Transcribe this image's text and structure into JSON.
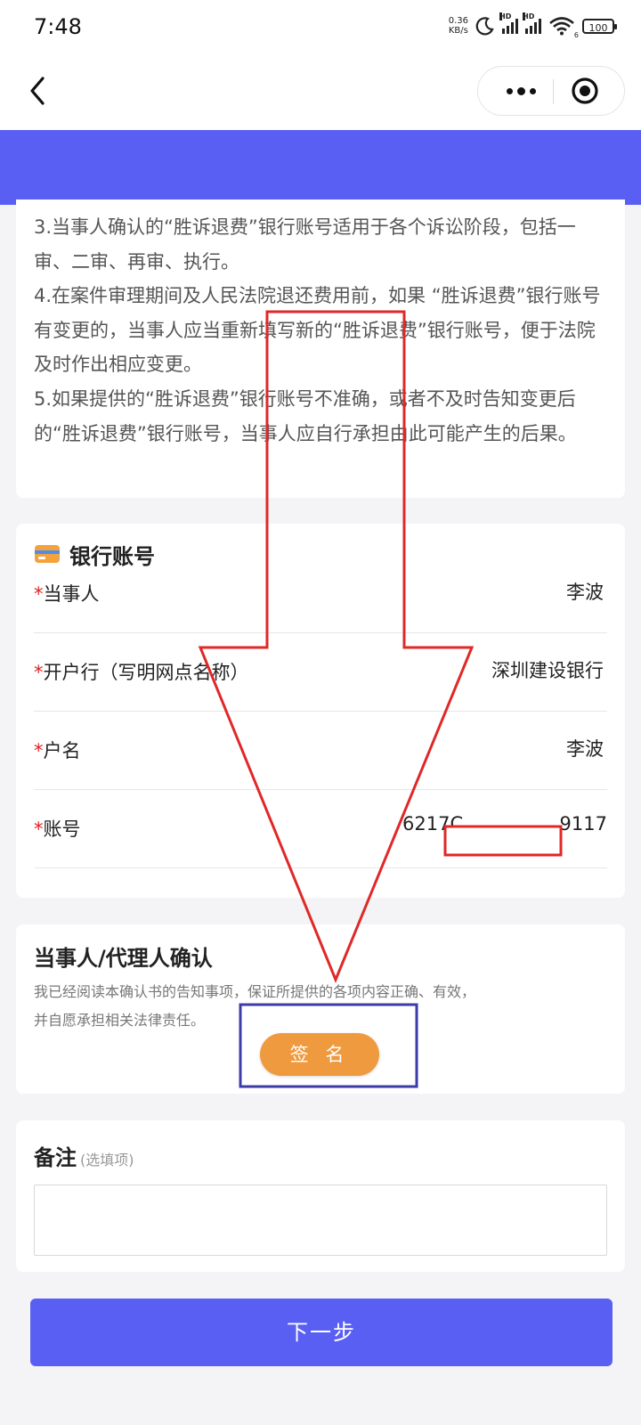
{
  "status_bar": {
    "time": "7:48",
    "net_speed_value": "0.36",
    "net_speed_unit": "KB/s",
    "signal_label_1": "HD",
    "signal_label_2": "HD",
    "wifi_label": "6",
    "battery": "100",
    "icons": [
      "moon-icon",
      "signal-icon",
      "wifi-icon",
      "battery-icon"
    ]
  },
  "nav": {
    "back_icon": "chevron-left-icon",
    "more_icon": "more-dots-icon",
    "close_icon": "target-close-icon"
  },
  "notice": {
    "paragraphs": [
      "3.当事人确认的“胜诉退费”银行账号适用于各个诉讼阶段，包括一审、二审、再审、执行。",
      "4.在案件审理期间及人民法院退还费用前，如果 “胜诉退费”银行账号有变更的，当事人应当重新填写新的“胜诉退费”银行账号，便于法院及时作出相应变更。",
      "5.如果提供的“胜诉退费”银行账号不准确，或者不及时告知变更后的“胜诉退费”银行账号，当事人应自行承担由此可能产生的后果。"
    ]
  },
  "bank": {
    "title": "银行账号",
    "icon": "bank-card-icon",
    "rows": [
      {
        "label": "当事人",
        "value": "李波"
      },
      {
        "label": "开户行（写明网点名称）",
        "value": "深圳建设银行"
      },
      {
        "label": "户名",
        "value": "李波"
      },
      {
        "label": "账号",
        "value": "6217C",
        "value_end": "9117"
      }
    ]
  },
  "confirm": {
    "title": "当事人/代理人确认",
    "desc": "我已经阅读本确认书的告知事项，保证所提供的各项内容正确、有效，并自愿承担相关法律责任。",
    "sign_label": "签 名"
  },
  "remark": {
    "title": "备注",
    "optional": "(选填项)",
    "value": ""
  },
  "next_label": "下一步",
  "colors": {
    "primary": "#5a5ff3",
    "sign_button": "#ef9a3e",
    "annotation_red": "#e02828",
    "annotation_blue": "#3c3ca8",
    "required_star": "#e02020"
  }
}
